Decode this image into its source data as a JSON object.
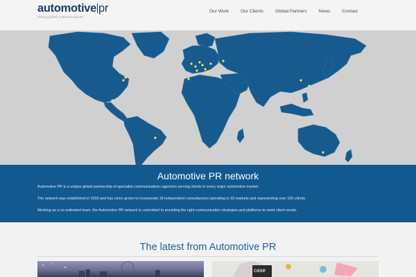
{
  "header": {
    "logo": {
      "main": "automotive",
      "suffix": "pr",
      "tagline": "driving global communications"
    },
    "nav": [
      "Our Work",
      "Our Clients",
      "Global Partners",
      "News",
      "Contact"
    ]
  },
  "map": {
    "ocean_color": "#12598f",
    "land_color": "#1a5a8e",
    "background": "#d0d0d0",
    "marker_color": "#f6e84a"
  },
  "network": {
    "title": "Automotive PR network",
    "paragraphs": [
      "Automotive PR is a unique global partnership of specialist communications agencies serving clients in every major automotive market.",
      "The network was established in 2003 and has since grown to incorporate 18 independent consultancies operating in 33 markets and representing over 100 clients.",
      "Working as a co-ordinated team, the Automotive PR network is committed to providing the right communication strategies and platforms to meet client needs."
    ],
    "band_color": "#12598f"
  },
  "latest": {
    "title": "The latest from Automotive PR",
    "thumb_right_text": "case"
  }
}
